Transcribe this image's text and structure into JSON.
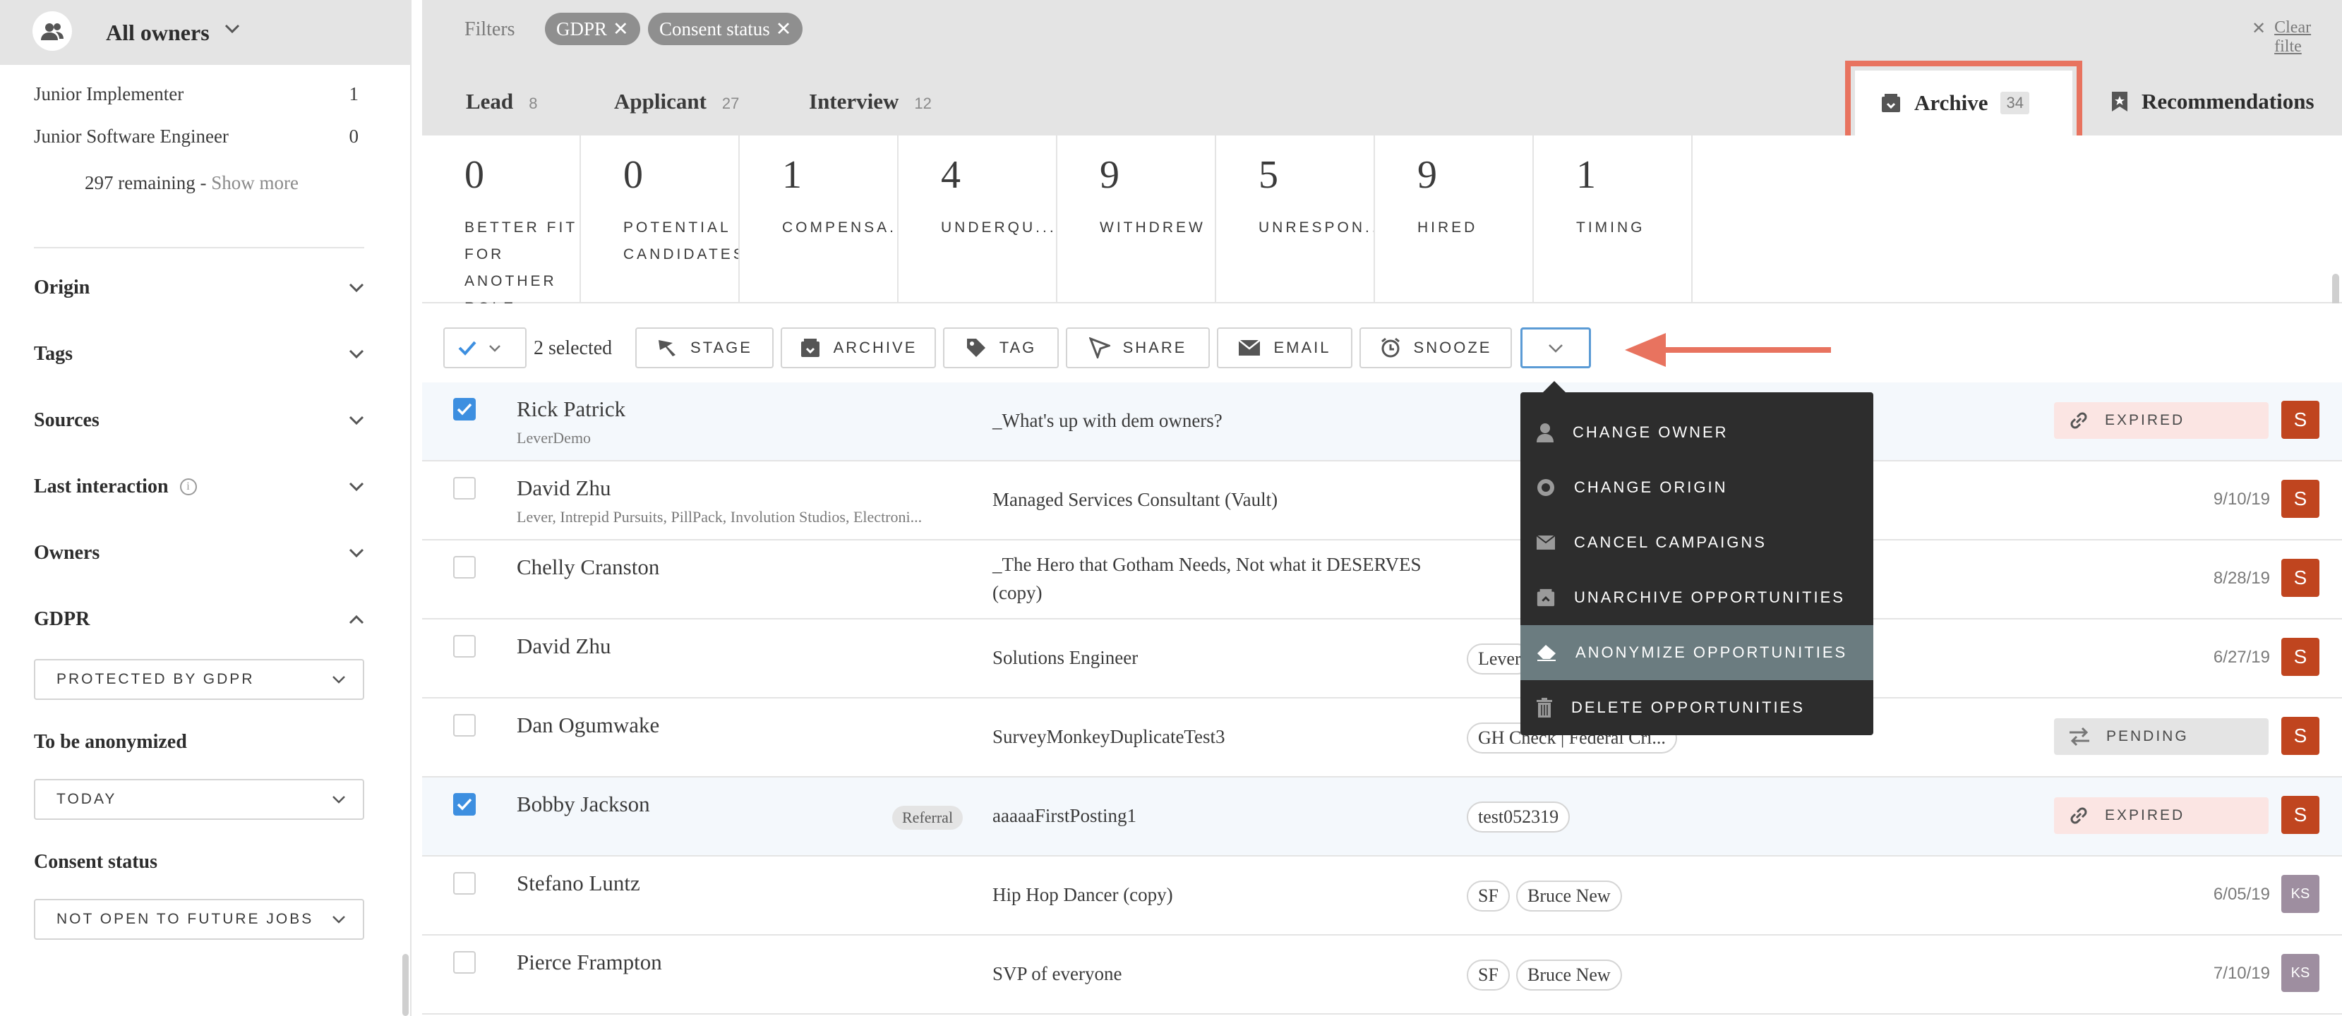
{
  "sidebar": {
    "owners_title": "All owners",
    "jobs": [
      {
        "name": "Junior Implementer",
        "count": "1"
      },
      {
        "name": "Junior Software Engineer",
        "count": "0"
      }
    ],
    "remaining_text": "297 remaining - ",
    "show_more": "Show more",
    "sections": [
      "Origin",
      "Tags",
      "Sources",
      "Last interaction",
      "Owners",
      "GDPR"
    ],
    "gdpr_value": "PROTECTED BY GDPR",
    "anonymized_label": "To be anonymized",
    "anonymized_value": "TODAY",
    "consent_label": "Consent status",
    "consent_value": "NOT OPEN TO FUTURE JOBS"
  },
  "filters": {
    "label": "Filters",
    "chips": [
      "GDPR",
      "Consent status"
    ],
    "clear": "Clear filte"
  },
  "tabs": [
    {
      "label": "Lead",
      "count": "8"
    },
    {
      "label": "Applicant",
      "count": "27"
    },
    {
      "label": "Interview",
      "count": "12"
    }
  ],
  "archive_tab": {
    "label": "Archive",
    "count": "34"
  },
  "recommendations_tab": {
    "label": "Recommendations"
  },
  "stats": [
    {
      "num": "0",
      "label": "BETTER FIT FOR ANOTHER ROLE"
    },
    {
      "num": "0",
      "label": "POTENTIAL CANDIDATES"
    },
    {
      "num": "1",
      "label": "COMPENSA..."
    },
    {
      "num": "4",
      "label": "UNDERQU..."
    },
    {
      "num": "9",
      "label": "WITHDREW"
    },
    {
      "num": "5",
      "label": "UNRESPON..."
    },
    {
      "num": "9",
      "label": "HIRED"
    },
    {
      "num": "1",
      "label": "TIMING"
    }
  ],
  "toolbar": {
    "selected": "2 selected",
    "buttons": [
      "STAGE",
      "ARCHIVE",
      "TAG",
      "SHARE",
      "EMAIL",
      "SNOOZE"
    ]
  },
  "menu": {
    "items": [
      "CHANGE OWNER",
      "CHANGE ORIGIN",
      "CANCEL CAMPAIGNS",
      "UNARCHIVE OPPORTUNITIES",
      "ANONYMIZE OPPORTUNITIES",
      "DELETE OPPORTUNITIES"
    ]
  },
  "rows": [
    {
      "name": "Rick Patrick",
      "sub": "LeverDemo",
      "posting": "_What's up with dem owners?",
      "status": "EXPIRED",
      "owner": "S"
    },
    {
      "name": "David Zhu",
      "sub": "Lever, Intrepid Pursuits, PillPack, Involution Studios, Electroni...",
      "posting": "Managed Services Consultant (Vault)",
      "date": "9/10/19",
      "owner": "S"
    },
    {
      "name": "Chelly Cranston",
      "posting_line1": "_The Hero that Gotham Needs, Not what it DESERVES",
      "posting_line2": "(copy)",
      "date": "8/28/19",
      "owner": "S"
    },
    {
      "name": "David Zhu",
      "posting": "Solutions Engineer",
      "tag": "Lever",
      "date": "6/27/19",
      "owner": "S"
    },
    {
      "name": "Dan Ogumwake",
      "posting": "SurveyMonkeyDuplicateTest3",
      "tag": "GH Check | Federal Cri...",
      "status": "PENDING",
      "owner": "S"
    },
    {
      "name": "Bobby Jackson",
      "ref": "Referral",
      "posting": "aaaaaFirstPosting1",
      "tag": "test052319",
      "status": "EXPIRED",
      "owner": "S"
    },
    {
      "name": "Stefano Luntz",
      "posting": "Hip Hop Dancer (copy)",
      "tag1": "SF",
      "tag2": "Bruce New",
      "date": "6/05/19",
      "owner": "KS"
    },
    {
      "name": "Pierce Frampton",
      "posting": "SVP of everyone",
      "tag1": "SF",
      "tag2": "Bruce New",
      "date": "7/10/19",
      "owner": "KS"
    }
  ],
  "colors": {
    "accent_blue": "#3d8fe0",
    "annotation_red": "#e8735f",
    "owner_red": "#c0451f"
  }
}
